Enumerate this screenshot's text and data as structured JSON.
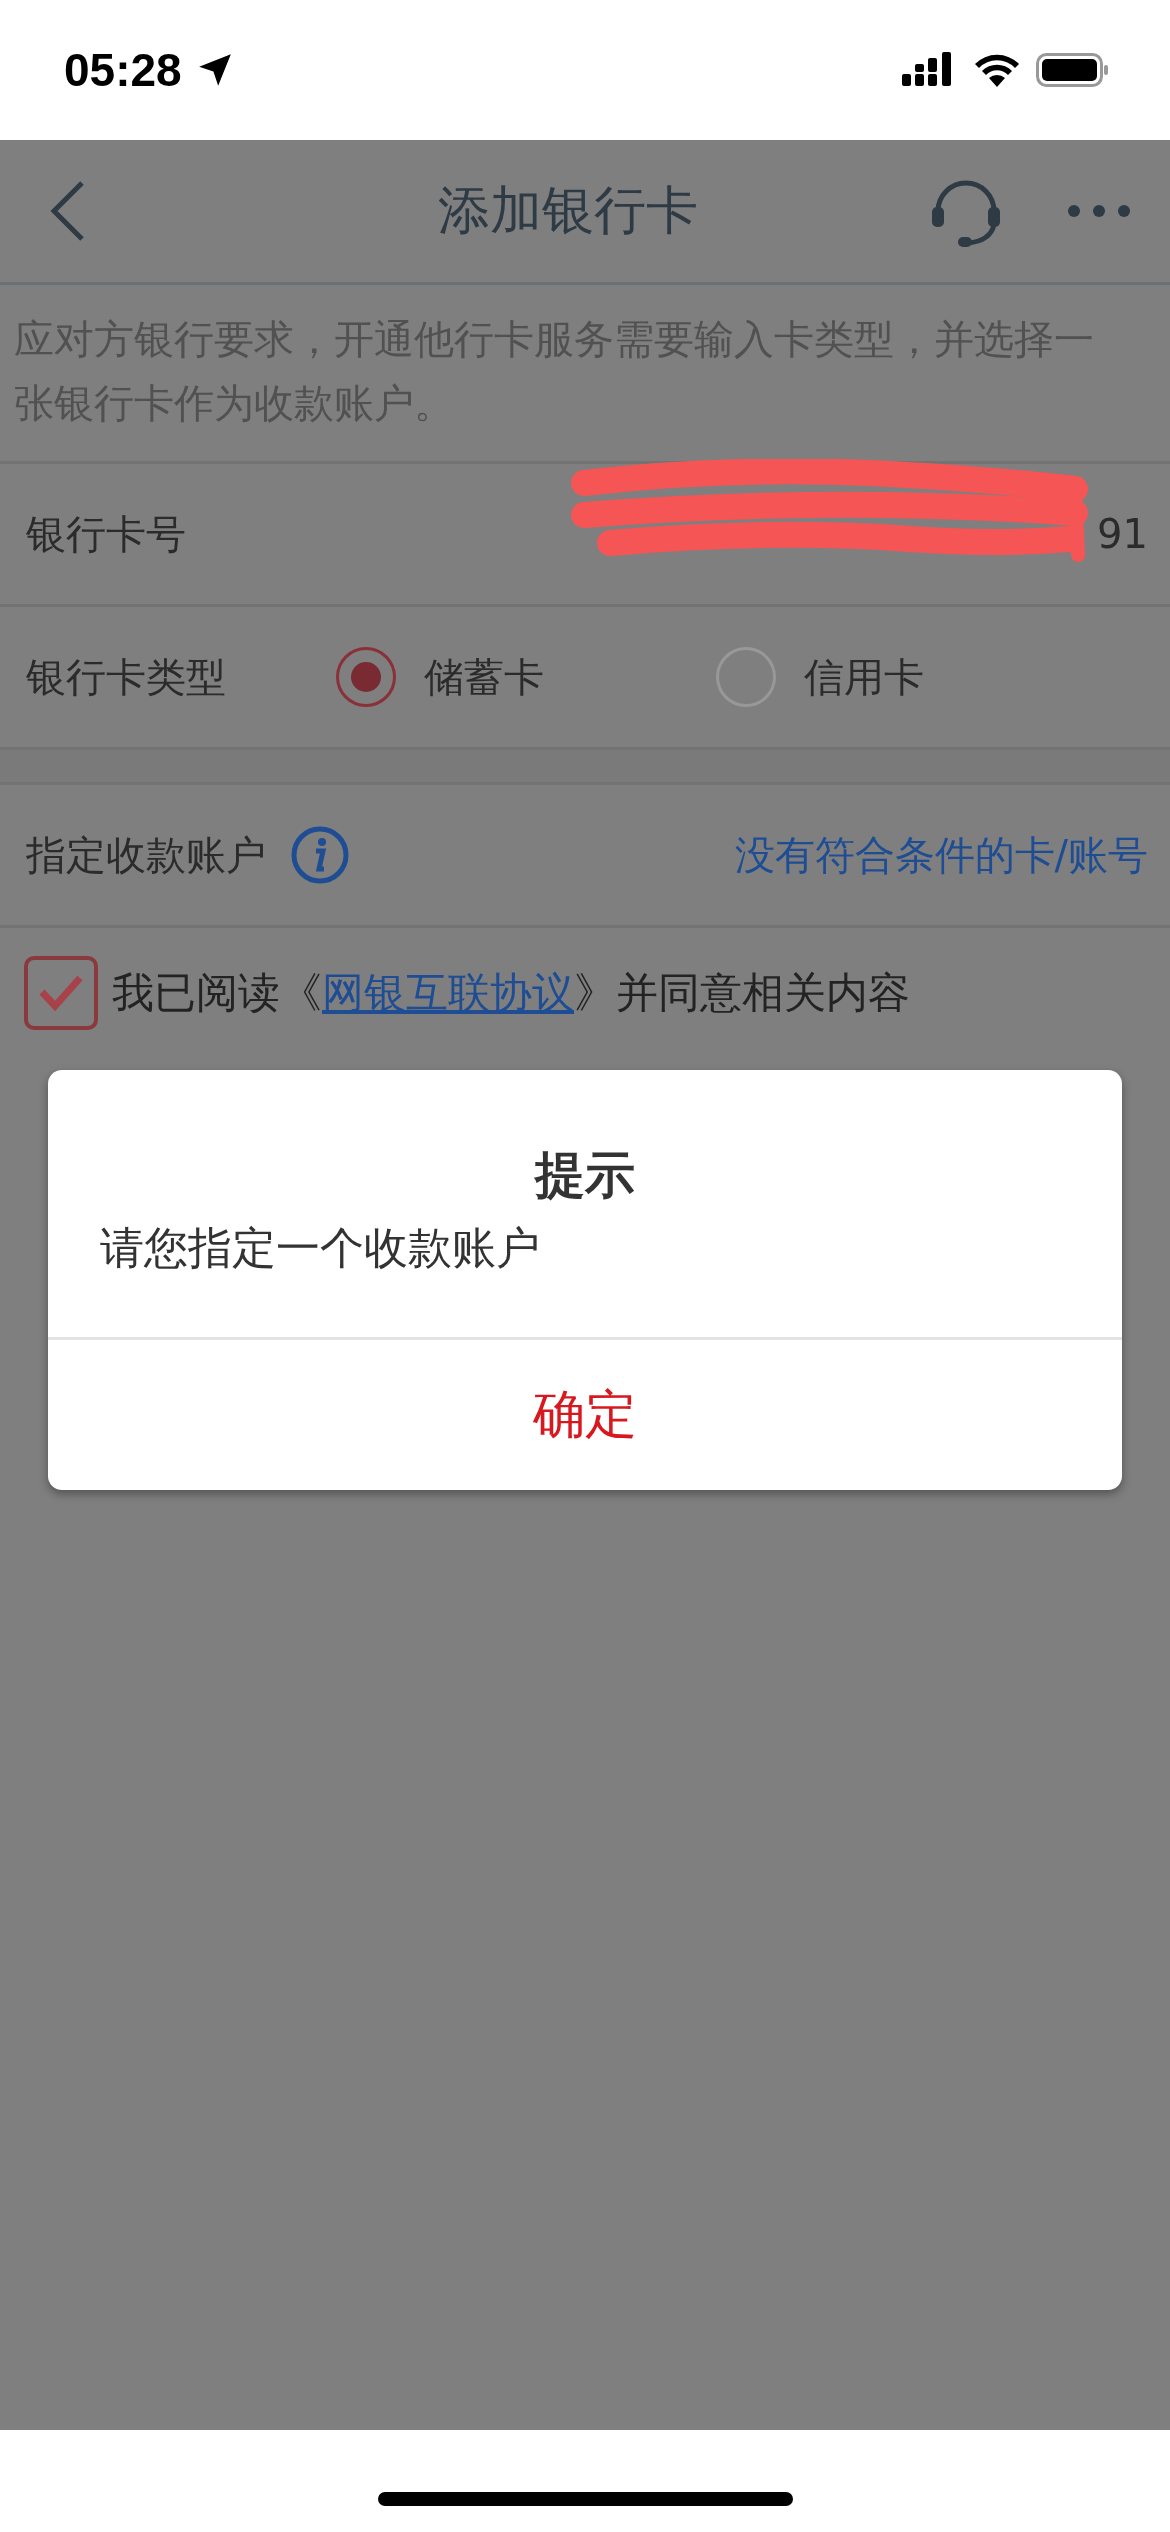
{
  "status_bar": {
    "time": "05:28"
  },
  "nav": {
    "title": "添加银行卡"
  },
  "notice": "应对方银行要求，开通他行卡服务需要输入卡类型，并选择一张银行卡作为收款账户。",
  "card_number": {
    "label": "银行卡号",
    "value": "91"
  },
  "card_type": {
    "label": "银行卡类型",
    "options": [
      {
        "label": "储蓄卡",
        "selected": true
      },
      {
        "label": "信用卡",
        "selected": false
      }
    ]
  },
  "account": {
    "label": "指定收款账户",
    "link": "没有符合条件的卡/账号"
  },
  "agreement": {
    "checked": true,
    "before": "我已阅读《",
    "link": "网银互联协议",
    "after": "》并同意相关内容"
  },
  "dialog": {
    "title": "提示",
    "message": "请您指定一个收款账户",
    "button": "确定"
  }
}
